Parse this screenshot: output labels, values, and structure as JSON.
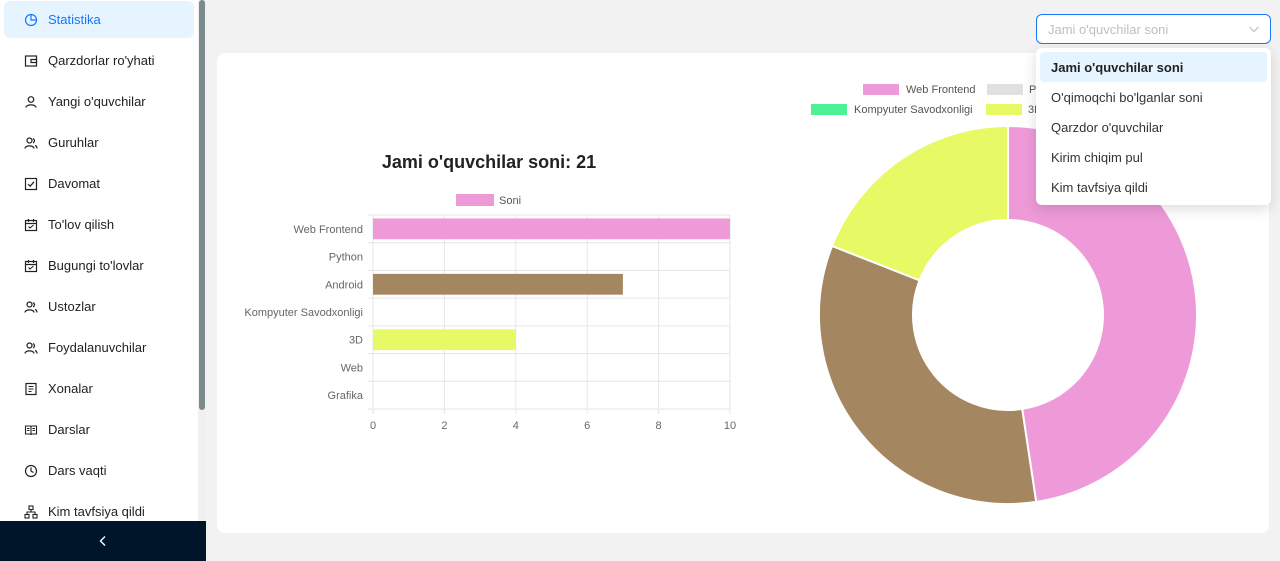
{
  "sidebar": {
    "items": [
      {
        "label": "Statistika",
        "icon": "pie-chart-icon",
        "active": true
      },
      {
        "label": "Qarzdorlar ro'yhati",
        "icon": "wallet-icon"
      },
      {
        "label": "Yangi o'quvchilar",
        "icon": "user-icon"
      },
      {
        "label": "Guruhlar",
        "icon": "users-icon"
      },
      {
        "label": "Davomat",
        "icon": "checkbox-icon"
      },
      {
        "label": "To'lov qilish",
        "icon": "calendar-icon"
      },
      {
        "label": "Bugungi to'lovlar",
        "icon": "calendar-icon"
      },
      {
        "label": "Ustozlar",
        "icon": "users-icon"
      },
      {
        "label": "Foydalanuvchilar",
        "icon": "users-icon"
      },
      {
        "label": "Xonalar",
        "icon": "document-icon"
      },
      {
        "label": "Darslar",
        "icon": "book-icon"
      },
      {
        "label": "Dars vaqti",
        "icon": "clock-icon"
      },
      {
        "label": "Kim tavfsiya qildi",
        "icon": "network-icon"
      }
    ],
    "collapse_icon": "chevron-left-icon"
  },
  "select": {
    "placeholder": "Jami o'quvchilar soni",
    "options": [
      "Jami o'quvchilar soni",
      "O'qimoqchi bo'lganlar soni",
      "Qarzdor o'quvchilar",
      "Kirim chiqim pul",
      "Kim tavfsiya qildi"
    ],
    "selected_index": 0
  },
  "chart_data": [
    {
      "type": "bar",
      "orientation": "horizontal",
      "title": "Jami o'quvchilar soni: 21",
      "legend": [
        "Soni"
      ],
      "categories": [
        "Web Frontend",
        "Python",
        "Android",
        "Kompyuter Savodxonligi",
        "3D",
        "Web",
        "Grafika"
      ],
      "values": [
        10,
        0,
        7,
        0,
        4,
        0,
        0
      ],
      "colors": [
        "#ee9ad9",
        "#e0e0e0",
        "#a48760",
        "#4df294",
        "#e7f964",
        "#b7c5f5",
        "#f6c27a"
      ],
      "xlim": [
        0,
        10
      ],
      "xticks": [
        "0",
        "2",
        "4",
        "6",
        "8",
        "10"
      ],
      "legend_color": "#ee9ad9",
      "grid": true
    },
    {
      "type": "pie",
      "donut": true,
      "legend_visible": [
        "Web Frontend",
        "P",
        "Kompyuter Savodxonligi",
        "3D"
      ],
      "slices": [
        {
          "label": "Web Frontend",
          "value": 10,
          "color": "#ee9ad9"
        },
        {
          "label": "Android",
          "value": 7,
          "color": "#a48760"
        },
        {
          "label": "3D",
          "value": 4,
          "color": "#e7f964"
        }
      ],
      "legend_colors": [
        "#ee9ad9",
        "#e0e0e0",
        "#4df294",
        "#e7f964"
      ]
    }
  ]
}
